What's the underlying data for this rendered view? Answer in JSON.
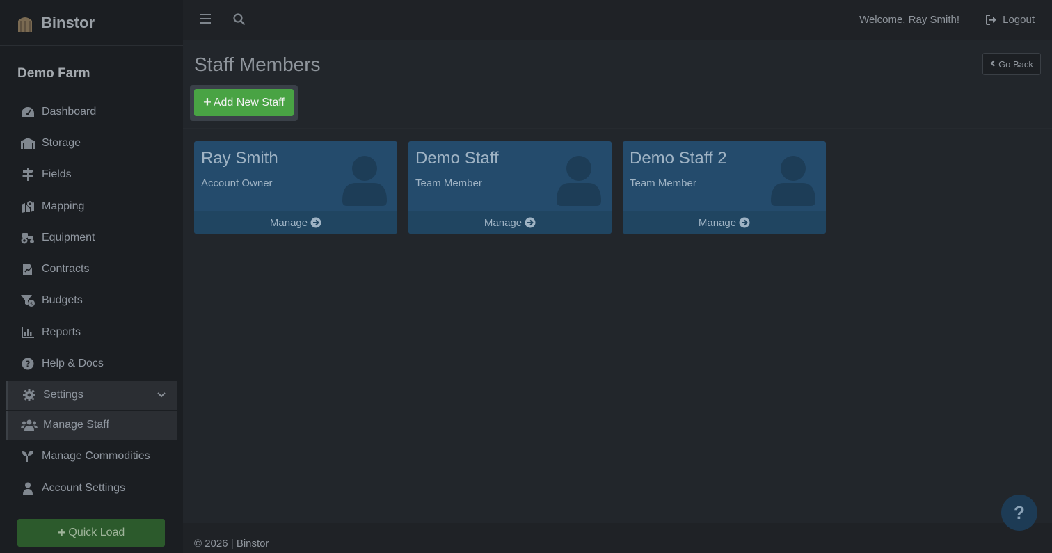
{
  "brand": {
    "name": "Binstor",
    "logo_icon": "silo-icon"
  },
  "sidebar": {
    "farm_name": "Demo Farm",
    "items": [
      {
        "label": "Dashboard",
        "icon": "gauge-icon"
      },
      {
        "label": "Storage",
        "icon": "warehouse-icon"
      },
      {
        "label": "Fields",
        "icon": "signs-icon"
      },
      {
        "label": "Mapping",
        "icon": "map-pin-icon"
      },
      {
        "label": "Equipment",
        "icon": "tractor-icon"
      },
      {
        "label": "Contracts",
        "icon": "contract-icon"
      },
      {
        "label": "Budgets",
        "icon": "funnel-dollar-icon"
      },
      {
        "label": "Reports",
        "icon": "bar-chart-icon"
      },
      {
        "label": "Help & Docs",
        "icon": "question-circle-icon"
      },
      {
        "label": "Settings",
        "icon": "gear-icon"
      },
      {
        "label": "Manage Staff",
        "icon": "users-icon"
      },
      {
        "label": "Manage Commodities",
        "icon": "seedling-icon"
      },
      {
        "label": "Account Settings",
        "icon": "user-icon"
      }
    ],
    "quick_load": "Quick Load"
  },
  "topbar": {
    "welcome": "Welcome, Ray Smith!",
    "logout": "Logout"
  },
  "main": {
    "title": "Staff Members",
    "go_back": "Go Back",
    "add_staff": "Add New Staff",
    "staff": [
      {
        "name": "Ray Smith",
        "role": "Account Owner",
        "action": "Manage"
      },
      {
        "name": "Demo Staff",
        "role": "Team Member",
        "action": "Manage"
      },
      {
        "name": "Demo Staff 2",
        "role": "Team Member",
        "action": "Manage"
      }
    ]
  },
  "footer": {
    "text": "© 2026 | Binstor"
  },
  "help_fab": {
    "label": "?"
  },
  "colors": {
    "accent_green": "#49a344",
    "card_blue": "#244b6c",
    "sidebar_bg": "#1b1e22",
    "content_bg": "#22262b"
  }
}
